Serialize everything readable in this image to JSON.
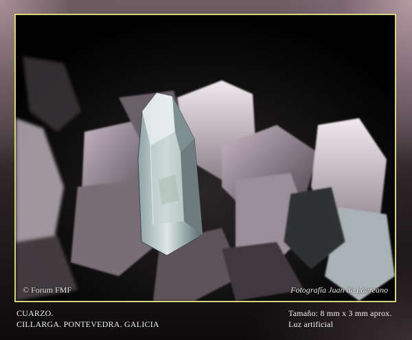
{
  "photo": {
    "copyright": "© Forum FMF",
    "credit": "Fotografía Juan de Laureano"
  },
  "caption": {
    "mineral": "CUARZO.",
    "locality": "CILLARGA. PONTEVEDRA. GALICIA",
    "size": "Tamaño: 8 mm x 3 mm aprox.",
    "lighting": "Luz artificial"
  },
  "colors": {
    "border": "#d7d67a",
    "background": "#000000"
  }
}
